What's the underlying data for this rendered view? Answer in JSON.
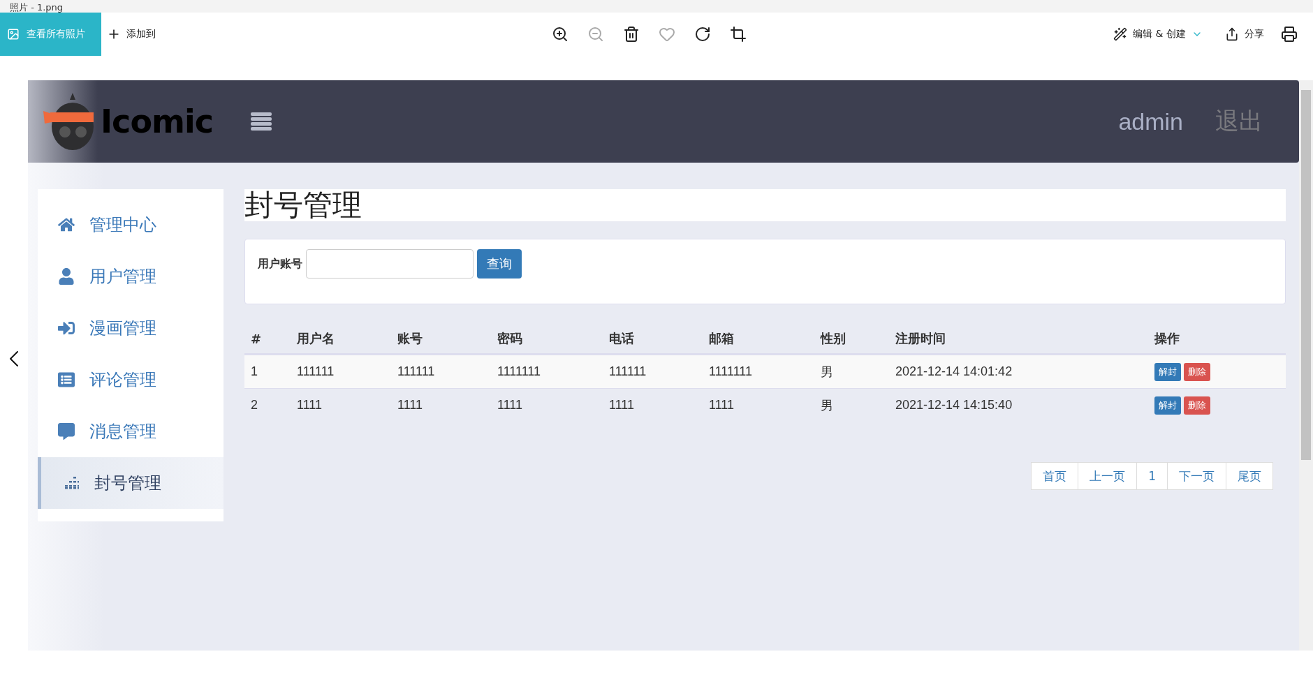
{
  "window": {
    "title": "照片 - 1.png"
  },
  "toolbar": {
    "view_all": "查看所有照片",
    "add_to": "添加到",
    "edit_create": "编辑 & 创建",
    "share": "分享"
  },
  "site": {
    "logo": "Icomic",
    "user": "admin",
    "logout": "退出"
  },
  "sidebar": {
    "items": [
      {
        "label": "管理中心",
        "kind": "home",
        "selected": false
      },
      {
        "label": "用户管理",
        "kind": "user",
        "selected": false
      },
      {
        "label": "漫画管理",
        "kind": "signin",
        "selected": false
      },
      {
        "label": "评论管理",
        "kind": "list",
        "selected": false
      },
      {
        "label": "消息管理",
        "kind": "comment",
        "selected": false
      },
      {
        "label": "封号管理",
        "kind": "bars",
        "selected": true
      }
    ]
  },
  "page": {
    "title": "封号管理"
  },
  "search": {
    "label": "用户账号",
    "button": "查询"
  },
  "table": {
    "columns": [
      "#",
      "用户名",
      "账号",
      "密码",
      "电话",
      "邮箱",
      "性别",
      "注册时间",
      "操作"
    ],
    "rows": [
      {
        "cells": [
          "1",
          "111111",
          "111111",
          "1111111",
          "111111",
          "1111111",
          "男",
          "2021-12-14 14:01:42"
        ],
        "actions": [
          "解封",
          "删除"
        ]
      },
      {
        "cells": [
          "2",
          "1111",
          "1111",
          "1111",
          "1111",
          "1111",
          "男",
          "2021-12-14 14:15:40"
        ],
        "actions": [
          "解封",
          "删除"
        ]
      }
    ]
  },
  "pagination": [
    {
      "label": "首页"
    },
    {
      "label": "上一页"
    },
    {
      "label": "1"
    },
    {
      "label": "下一页"
    },
    {
      "label": "尾页"
    }
  ]
}
